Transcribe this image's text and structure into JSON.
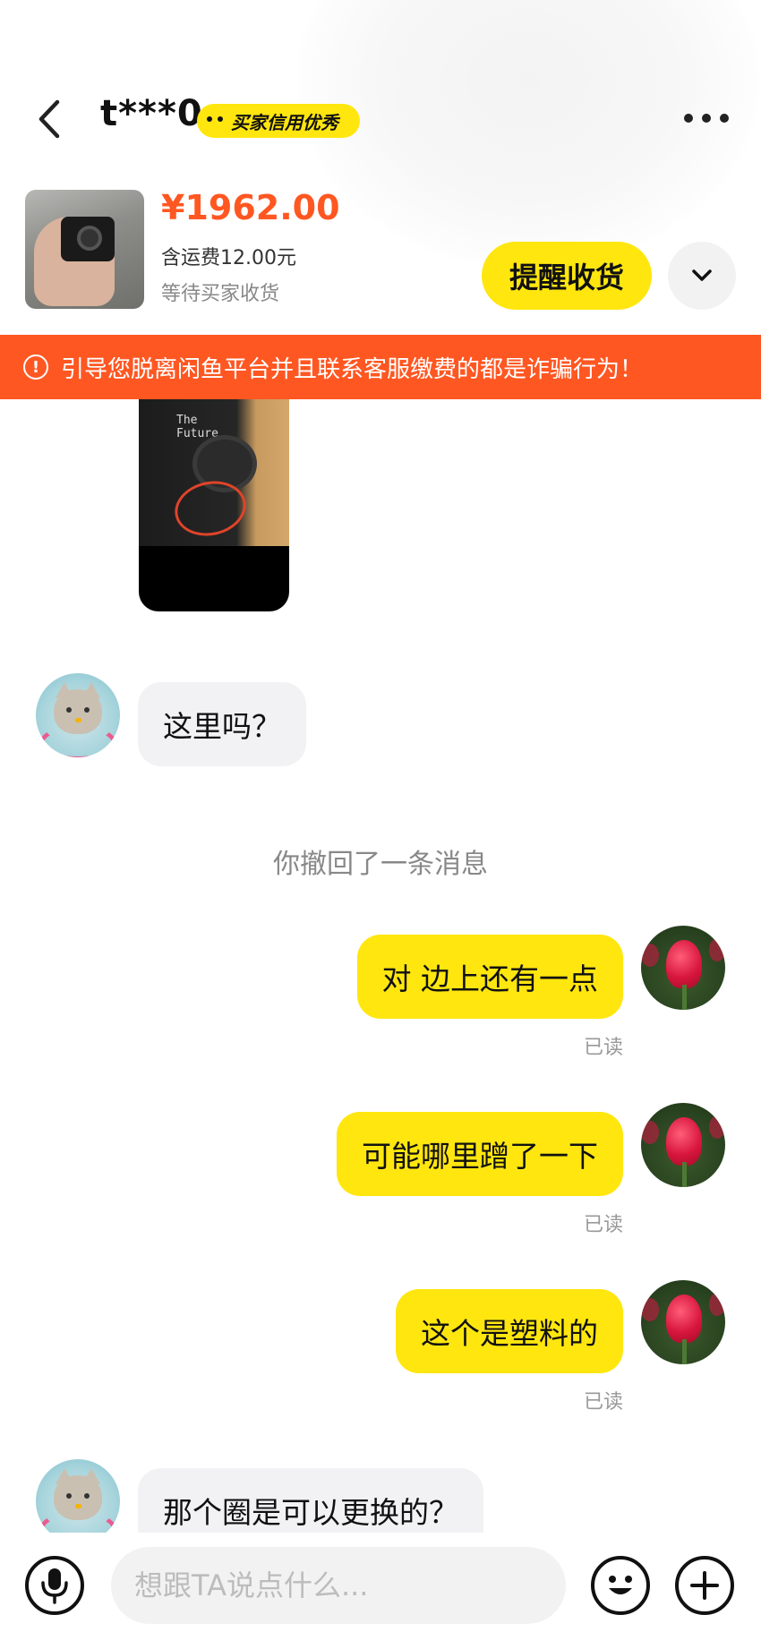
{
  "header": {
    "username": "t***0",
    "badge_label": "买家信用优秀"
  },
  "product": {
    "price": "¥1962.00",
    "shipping": "含运费12.00元",
    "status": "等待买家收货",
    "remind_label": "提醒收货"
  },
  "warning": {
    "text": "引导您脱离闲鱼平台并且联系客服缴费的都是诈骗行为！"
  },
  "chat_image": {
    "shirt_text": "The\nFuture"
  },
  "messages": [
    {
      "side": "in",
      "text": "这里吗？"
    },
    {
      "type": "system",
      "text": "你撤回了一条消息"
    },
    {
      "side": "out",
      "text": "对 边上还有一点",
      "read": "已读"
    },
    {
      "side": "out",
      "text": "可能哪里蹭了一下",
      "read": "已读"
    },
    {
      "side": "out",
      "text": "这个是塑料的",
      "read": "已读"
    },
    {
      "side": "in",
      "text": "那个圈是可以更换的？"
    }
  ],
  "input": {
    "placeholder": "想跟TA说点什么..."
  },
  "colors": {
    "accent_yellow": "#ffe60f",
    "price_orange": "#ff5722",
    "warning_bg": "#ff5722",
    "incoming_bubble": "#f2f2f5"
  },
  "icons": [
    "chevron-left-icon",
    "more-dots-icon",
    "chevron-down-icon",
    "warning-icon",
    "microphone-icon",
    "emoji-icon",
    "plus-icon"
  ]
}
